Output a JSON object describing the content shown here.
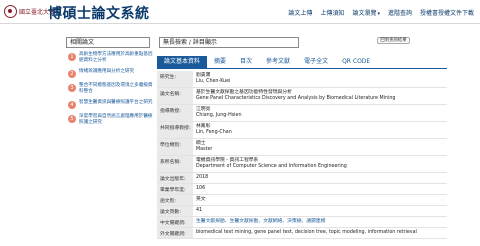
{
  "header": {
    "university_name": "國立臺北大學",
    "system_title": "博碩士論文系統",
    "nav": [
      {
        "label": "論文上傳"
      },
      {
        "label": "上傳須知"
      },
      {
        "label": "論文瀏覽",
        "has_dropdown": true
      },
      {
        "label": "進階查詢"
      },
      {
        "label": "授權書授權文件下載"
      }
    ]
  },
  "sidebar": {
    "heading": "相關論文",
    "items": [
      {
        "number": "1",
        "text": "高齡生物學方法應用於高齡重點基因組資料之分析"
      },
      {
        "number": "2",
        "text": "情緒辨識應用與分析之研究"
      },
      {
        "number": "3",
        "text": "整合不同模態基因及環境之多層級資料整合"
      },
      {
        "number": "4",
        "text": "智慧生醫資訊與醫療照護平台之研究"
      },
      {
        "number": "5",
        "text": "深度學習與自然語言處理應用於醫療照護之研究"
      }
    ]
  },
  "main": {
    "title_box": "無長檢索 / 詳目顯示",
    "back_button": "回到查詢結果",
    "tabs": [
      "論文基本資料",
      "摘要",
      "目次",
      "參考文獻",
      "電子全文",
      "QR CODE"
    ],
    "active_tab": 0,
    "rows": [
      {
        "label": "研究生:",
        "lines": [
          "劉貴寶",
          "Liu, Chen-Kuei"
        ]
      },
      {
        "label": "論文名稱:",
        "lines": [
          "基於生醫文獻探勘之基因功能特性發現與分析",
          "Gene Panel Characteristics Discovery and Analysis by Biomedical Literature Mining"
        ]
      },
      {
        "label": "指導教授:",
        "lines": [
          "江明亮",
          "Chiang, Jung-Hsien"
        ]
      },
      {
        "label": "共同指導教授:",
        "lines": [
          "林鳳彰",
          "Lin, Feng-Chan"
        ]
      },
      {
        "label": "學位類別:",
        "lines": [
          "碩士",
          "Master"
        ]
      },
      {
        "label": "系所名稱:",
        "lines": [
          "電機資訊學院 - 資訊工程學系",
          "Department of Computer Science and Information Engineering"
        ]
      },
      {
        "label": "論文出版年:",
        "lines": [
          "2018"
        ]
      },
      {
        "label": "畢業學年度:",
        "lines": [
          "106"
        ]
      },
      {
        "label": "語文別:",
        "lines": [
          "英文"
        ]
      },
      {
        "label": "論文頁數:",
        "lines": [
          "41"
        ]
      },
      {
        "label": "中文關鍵詞:",
        "lines": [
          "生醫文獻探勘、生醫文獻探勘、文獻網絡、決策樹、議題建模"
        ],
        "link": true
      },
      {
        "label": "外文關鍵詞:",
        "lines": [
          "biomedical text mining, gene panel test, decision tree, topic modeling, information retrieval"
        ]
      }
    ]
  }
}
